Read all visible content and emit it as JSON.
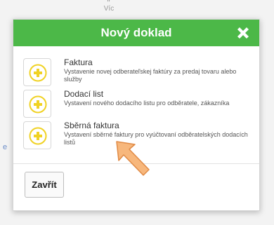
{
  "background": {
    "more_label": "Víc",
    "edge_letter": "e"
  },
  "modal": {
    "title": "Nový doklad",
    "close_icon": "close-x-icon",
    "header_color": "#4cb848",
    "accent_color": "#f0d224",
    "items": [
      {
        "title": "Faktura",
        "description": "Vystavenie novej odberateľskej faktúry za predaj tovaru alebo služby",
        "icon": "plus-circle-icon"
      },
      {
        "title": "Dodací list",
        "description": "Vystavení nového dodacího listu pro odběratele, zákazníka",
        "icon": "plus-circle-icon"
      },
      {
        "title": "Sběrná faktura",
        "description": "Vystavení sběrné faktury pro vyúčtovaní odběratelských dodacích listů",
        "icon": "plus-circle-icon"
      }
    ],
    "close_button_label": "Zavřít"
  },
  "annotation": {
    "icon": "pointer-arrow-icon",
    "color": "#f7b77c"
  }
}
